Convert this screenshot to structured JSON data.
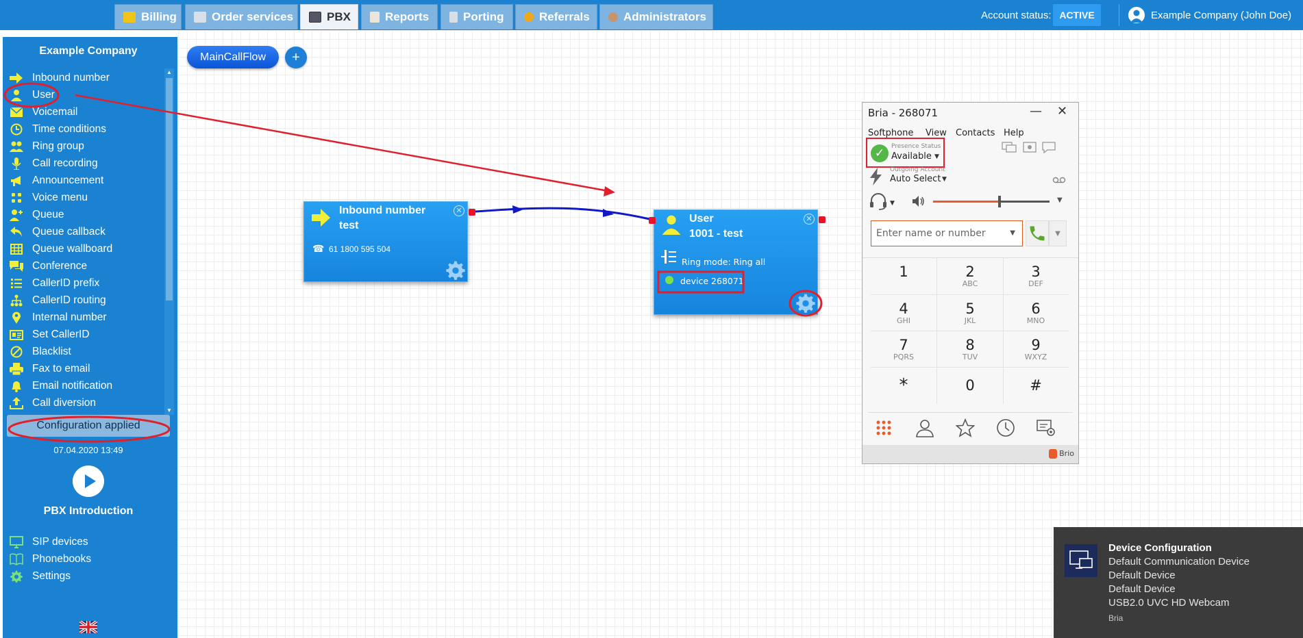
{
  "topbar": {
    "tabs": [
      {
        "label": "Billing",
        "icon": "coins-icon"
      },
      {
        "label": "Order services",
        "icon": "cart-icon"
      },
      {
        "label": "PBX",
        "icon": "pbx-icon"
      },
      {
        "label": "Reports",
        "icon": "report-icon"
      },
      {
        "label": "Porting",
        "icon": "phone-icon"
      },
      {
        "label": "Referrals",
        "icon": "person-icon"
      },
      {
        "label": "Administrators",
        "icon": "admin-icon"
      }
    ],
    "active_tab": "PBX",
    "account_status_label": "Account status:",
    "account_status_value": "ACTIVE",
    "user_name": "Example Company (John Doe)"
  },
  "sidebar": {
    "company": "Example Company",
    "items": [
      {
        "label": "Inbound number",
        "icon": "arrow-right-icon"
      },
      {
        "label": "User",
        "icon": "user-icon"
      },
      {
        "label": "Voicemail",
        "icon": "envelope-icon"
      },
      {
        "label": "Time conditions",
        "icon": "clock-icon"
      },
      {
        "label": "Ring group",
        "icon": "users-icon"
      },
      {
        "label": "Call recording",
        "icon": "microphone-icon"
      },
      {
        "label": "Announcement",
        "icon": "megaphone-icon"
      },
      {
        "label": "Voice menu",
        "icon": "grid-icon"
      },
      {
        "label": "Queue",
        "icon": "user-plus-icon"
      },
      {
        "label": "Queue callback",
        "icon": "reply-icon"
      },
      {
        "label": "Queue wallboard",
        "icon": "table-icon"
      },
      {
        "label": "Conference",
        "icon": "chat-icon"
      },
      {
        "label": "CallerID prefix",
        "icon": "list-icon"
      },
      {
        "label": "CallerID routing",
        "icon": "sitemap-icon"
      },
      {
        "label": "Internal number",
        "icon": "pin-icon"
      },
      {
        "label": "Set CallerID",
        "icon": "id-card-icon"
      },
      {
        "label": "Blacklist",
        "icon": "ban-icon"
      },
      {
        "label": "Fax to email",
        "icon": "fax-icon"
      },
      {
        "label": "Email notification",
        "icon": "bell-icon"
      },
      {
        "label": "Call diversion",
        "icon": "upload-icon"
      }
    ],
    "config_status": "Configuration applied",
    "config_date": "07.04.2020 13:49",
    "intro_label": "PBX Introduction",
    "links": [
      {
        "label": "SIP devices",
        "icon": "monitor-icon"
      },
      {
        "label": "Phonebooks",
        "icon": "book-icon"
      },
      {
        "label": "Settings",
        "icon": "gear-icon"
      }
    ]
  },
  "canvas": {
    "flow_tab": "MainCallFlow",
    "add_symbol": "+",
    "nodes": {
      "inbound": {
        "title_line1": "Inbound number",
        "title_line2": "test",
        "phone": "61 1800 595 504"
      },
      "user": {
        "title_line1": "User",
        "title_line2": "1001 - test",
        "ring_mode": "Ring mode: Ring all",
        "device": "device 268071"
      }
    }
  },
  "bria": {
    "title": "Bria - 268071",
    "menu": [
      "Softphone",
      "View",
      "Contacts",
      "Help"
    ],
    "presence_label": "Presence Status",
    "presence_value": "Available",
    "account_label": "Outgoing Account",
    "account_value": "Auto Select",
    "volume_percent": 57,
    "dial_placeholder": "Enter name or number",
    "keypad": [
      {
        "digit": "1",
        "letters": ""
      },
      {
        "digit": "2",
        "letters": "ABC"
      },
      {
        "digit": "3",
        "letters": "DEF"
      },
      {
        "digit": "4",
        "letters": "GHI"
      },
      {
        "digit": "5",
        "letters": "JKL"
      },
      {
        "digit": "6",
        "letters": "MNO"
      },
      {
        "digit": "7",
        "letters": "PQRS"
      },
      {
        "digit": "8",
        "letters": "TUV"
      },
      {
        "digit": "9",
        "letters": "WXYZ"
      },
      {
        "digit": "*",
        "letters": ""
      },
      {
        "digit": "0",
        "letters": ""
      },
      {
        "digit": "#",
        "letters": ""
      }
    ],
    "brand": "Brio"
  },
  "toast": {
    "title": "Device Configuration",
    "lines": [
      "Default Communication Device",
      "Default Device",
      "Default Device",
      "USB2.0 UVC HD Webcam"
    ],
    "source": "Bria"
  },
  "colors": {
    "primary": "#1a82d0",
    "annotation": "#e0202c",
    "node": "#1d8fe6",
    "link": "#1018c8",
    "accent": "#e95b2a"
  }
}
